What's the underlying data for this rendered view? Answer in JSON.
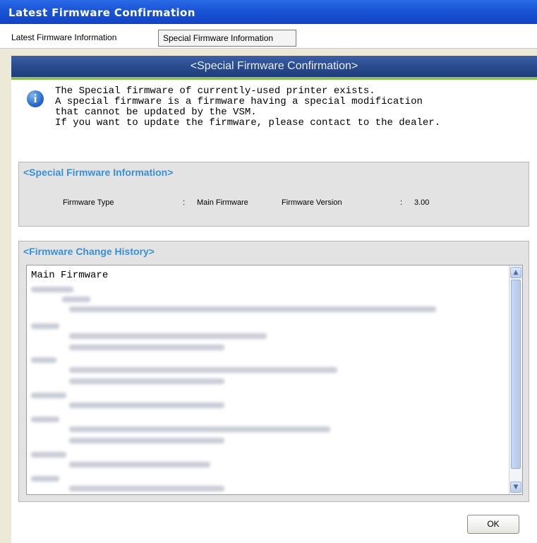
{
  "window": {
    "title": "Latest Firmware Confirmation"
  },
  "tabs": [
    {
      "label": "Latest Firmware Information"
    },
    {
      "label": "Special Firmware Information",
      "active": true
    }
  ],
  "banner": {
    "text": "<Special Firmware Confirmation>"
  },
  "message": {
    "icon": "info-icon",
    "lines": [
      "The Special firmware of currently-used printer exists.",
      "A special firmware is a firmware having a special modification",
      "that cannot be updated by the VSM.",
      "If you want to update the firmware, please contact to the dealer."
    ]
  },
  "special_info": {
    "legend": "<Special Firmware Information>",
    "firmware_type_label": "Firmware Type",
    "firmware_type_sep": ":",
    "firmware_type_value": "Main Firmware",
    "firmware_version_label": "Firmware Version",
    "firmware_version_sep": ":",
    "firmware_version_value": "3.00"
  },
  "history": {
    "legend": "<Firmware Change History>",
    "first_line": "Main Firmware"
  },
  "buttons": {
    "ok": "OK"
  },
  "colors": {
    "titlebar": "#1a54d6",
    "banner": "#2a4b8e",
    "accent_green": "#8fbf5a",
    "legend_blue": "#3b8fd6"
  }
}
